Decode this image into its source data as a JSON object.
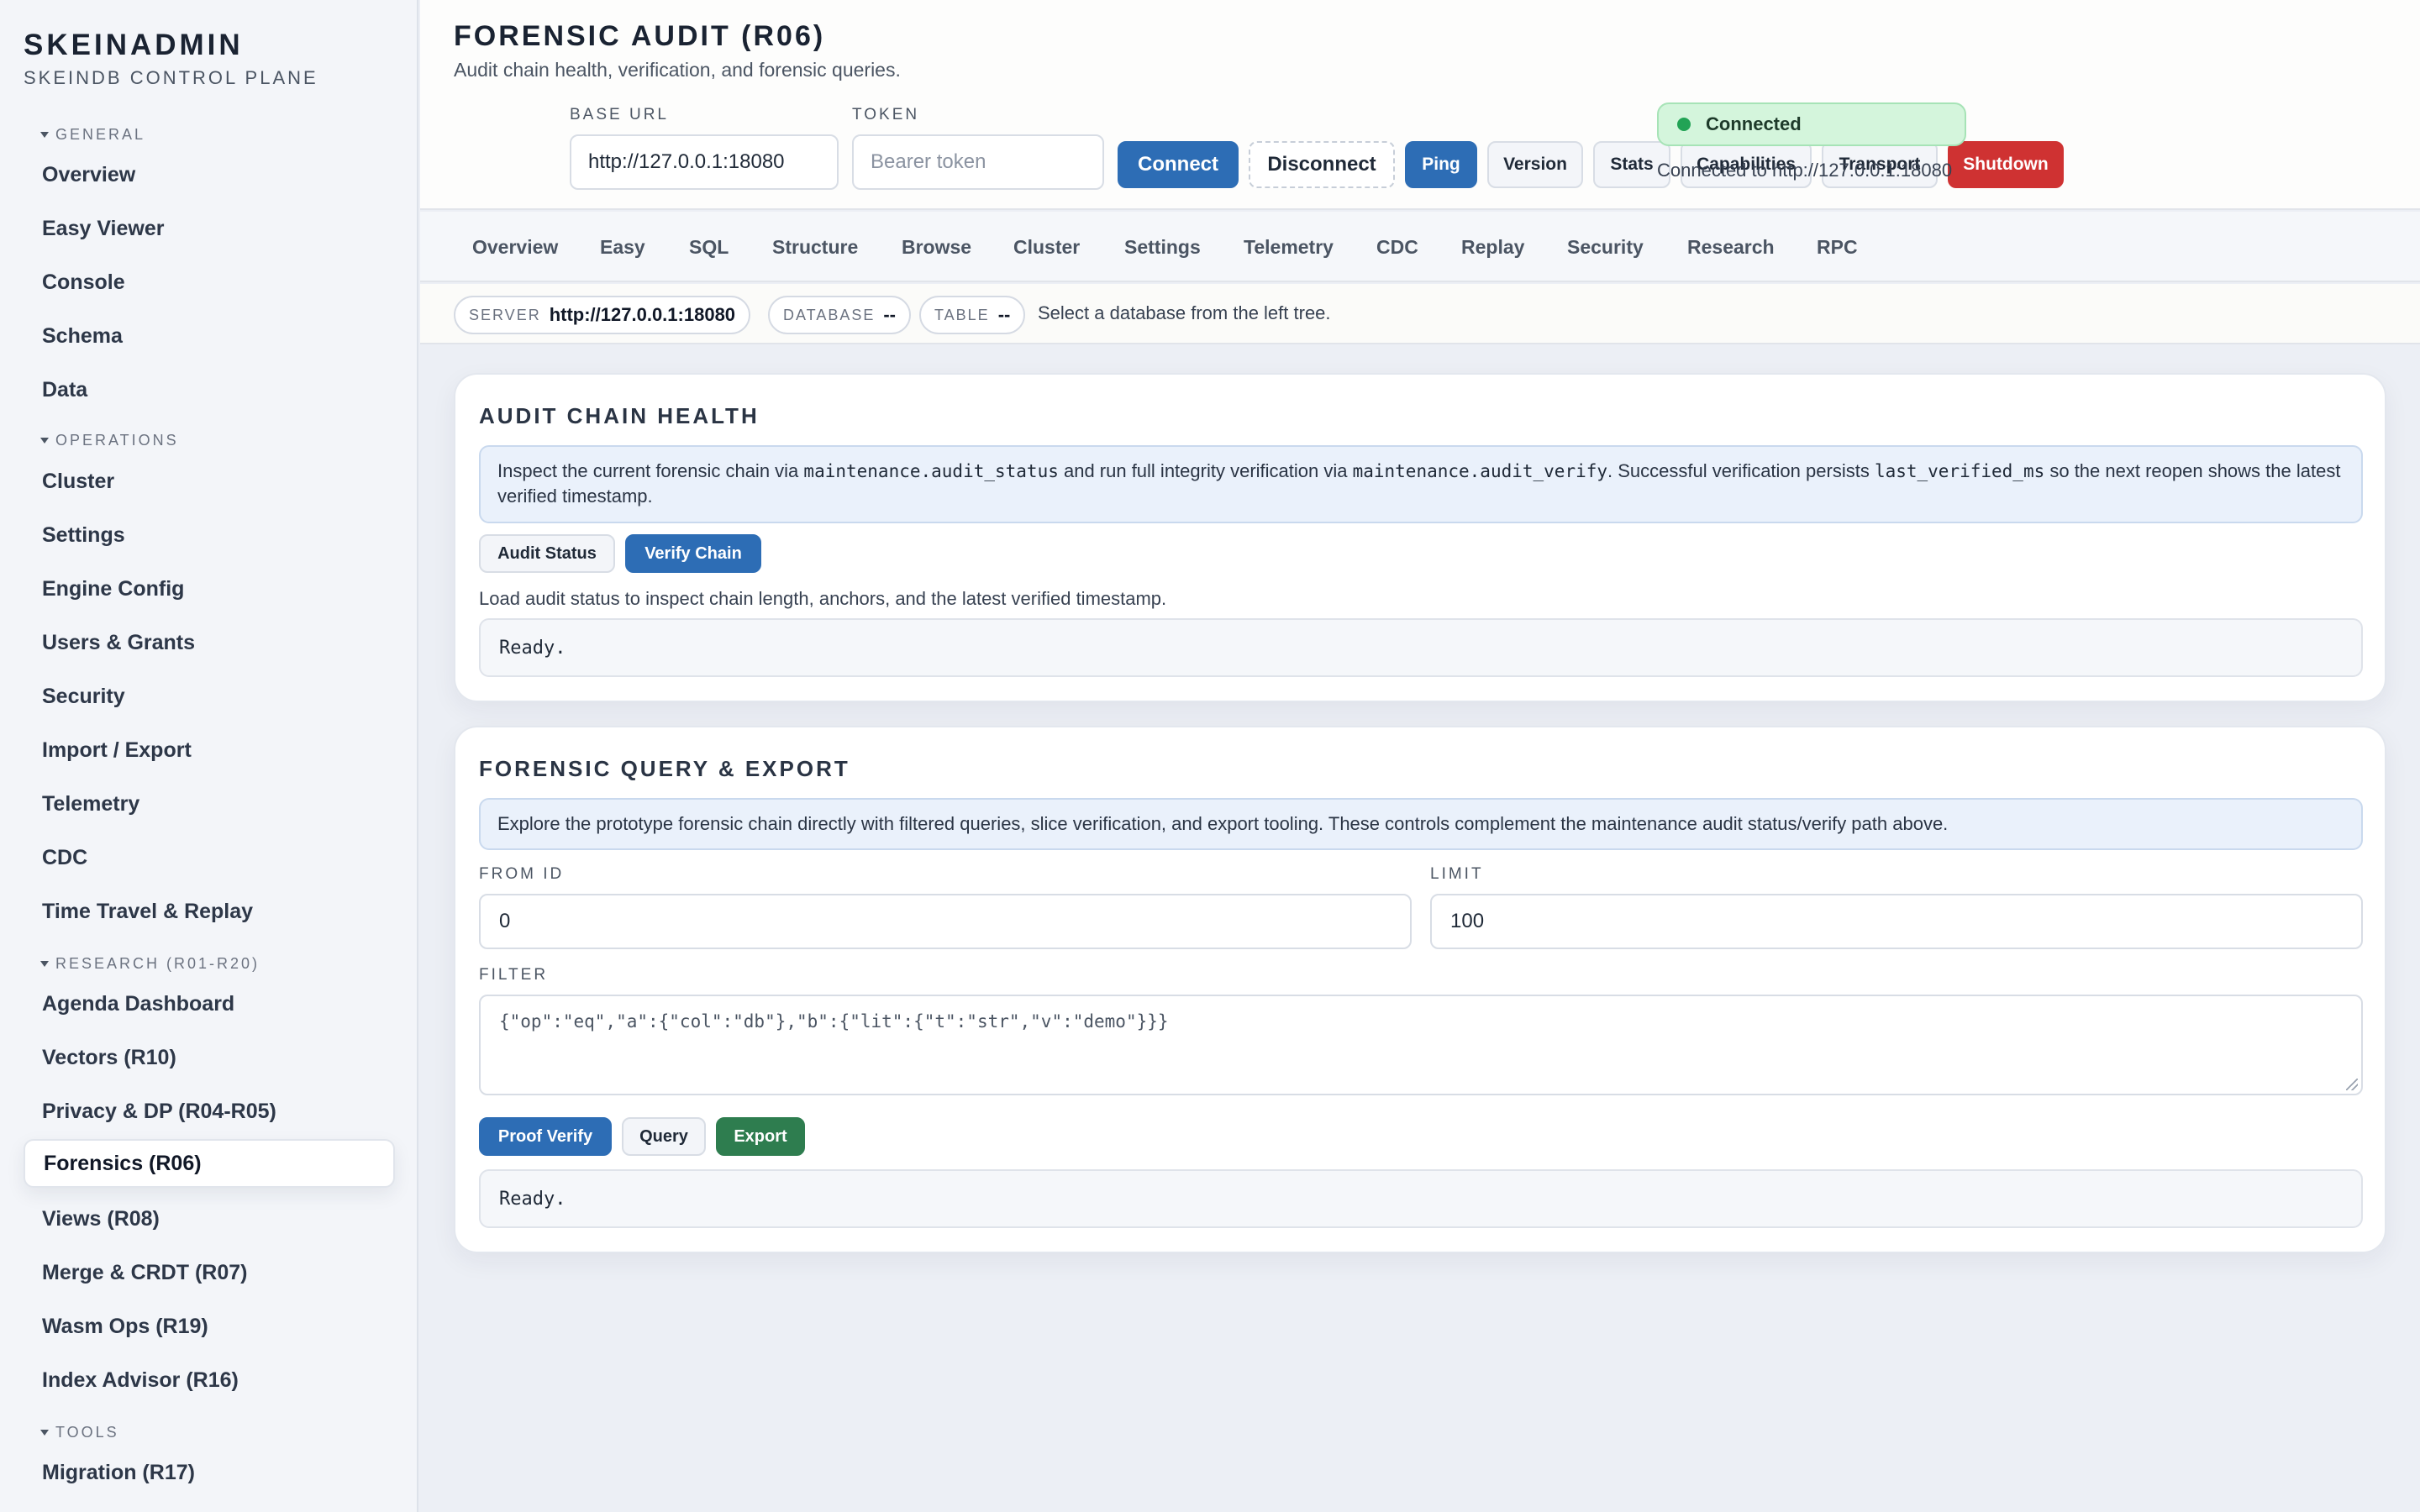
{
  "sidebar": {
    "brand_title": "SKEINADMIN",
    "brand_subtitle": "SKEINDB CONTROL PLANE",
    "sections": {
      "general": "GENERAL",
      "operations": "OPERATIONS",
      "research": "RESEARCH (R01-R20)",
      "tools": "TOOLS"
    },
    "items": {
      "overview": "Overview",
      "easy_viewer": "Easy Viewer",
      "console": "Console",
      "schema": "Schema",
      "data": "Data",
      "cluster": "Cluster",
      "settings": "Settings",
      "engine_config": "Engine Config",
      "users_grants": "Users & Grants",
      "security": "Security",
      "import_export": "Import / Export",
      "telemetry": "Telemetry",
      "cdc": "CDC",
      "time_travel": "Time Travel & Replay",
      "agenda": "Agenda Dashboard",
      "vectors": "Vectors (R10)",
      "privacy": "Privacy & DP (R04-R05)",
      "forensics": "Forensics (R06)",
      "views": "Views (R08)",
      "merge": "Merge & CRDT (R07)",
      "wasm": "Wasm Ops (R19)",
      "index_advisor": "Index Advisor (R16)",
      "migration": "Migration (R17)"
    },
    "active_item": "forensics"
  },
  "header": {
    "title": "FORENSIC AUDIT (R06)",
    "subtitle": "Audit chain health, verification, and forensic queries.",
    "base_url_label": "BASE URL",
    "base_url_value": "http://127.0.0.1:18080",
    "token_label": "TOKEN",
    "token_placeholder": "Bearer token",
    "buttons": {
      "connect": "Connect",
      "disconnect": "Disconnect",
      "ping": "Ping",
      "version": "Version",
      "stats": "Stats",
      "capabilities": "Capabilities",
      "transport": "Transport",
      "shutdown": "Shutdown"
    },
    "status_badge": "Connected",
    "status_text": "Connected to http://127.0.0.1:18080"
  },
  "tabs": [
    "Overview",
    "Easy",
    "SQL",
    "Structure",
    "Browse",
    "Cluster",
    "Settings",
    "Telemetry",
    "CDC",
    "Replay",
    "Security",
    "Research",
    "RPC"
  ],
  "context": {
    "server_label": "SERVER",
    "server_value": "http://127.0.0.1:18080",
    "database_label": "DATABASE",
    "database_value": "--",
    "table_label": "TABLE",
    "table_value": "--",
    "message": "Select a database from the left tree."
  },
  "audit_panel": {
    "title": "AUDIT CHAIN HEALTH",
    "info_1": "Inspect the current forensic chain via ",
    "info_code_1": "maintenance.audit_status",
    "info_2": " and run full integrity verification via ",
    "info_code_2": "maintenance.audit_verify",
    "info_3": ". Successful verification persists ",
    "info_code_3": "last_verified_ms",
    "info_4": " so the next reopen shows the latest verified timestamp.",
    "audit_status_button": "Audit Status",
    "verify_chain_button": "Verify Chain",
    "helper": "Load audit status to inspect chain length, anchors, and the latest verified timestamp.",
    "output": "Ready."
  },
  "query_panel": {
    "title": "FORENSIC QUERY & EXPORT",
    "info": "Explore the prototype forensic chain directly with filtered queries, slice verification, and export tooling. These controls complement the maintenance audit status/verify path above.",
    "from_id_label": "FROM ID",
    "from_id_value": "0",
    "limit_label": "LIMIT",
    "limit_value": "100",
    "filter_label": "FILTER",
    "filter_value": "{\"op\":\"eq\",\"a\":{\"col\":\"db\"},\"b\":{\"lit\":{\"t\":\"str\",\"v\":\"demo\"}}}",
    "proof_verify_button": "Proof Verify",
    "query_button": "Query",
    "export_button": "Export",
    "output": "Ready."
  },
  "colors": {
    "primary": "#2d6db5",
    "danger": "#cf3232",
    "success": "#2e7d4f",
    "connected_bg": "#d4f5dc",
    "connected_dot": "#22a355"
  }
}
